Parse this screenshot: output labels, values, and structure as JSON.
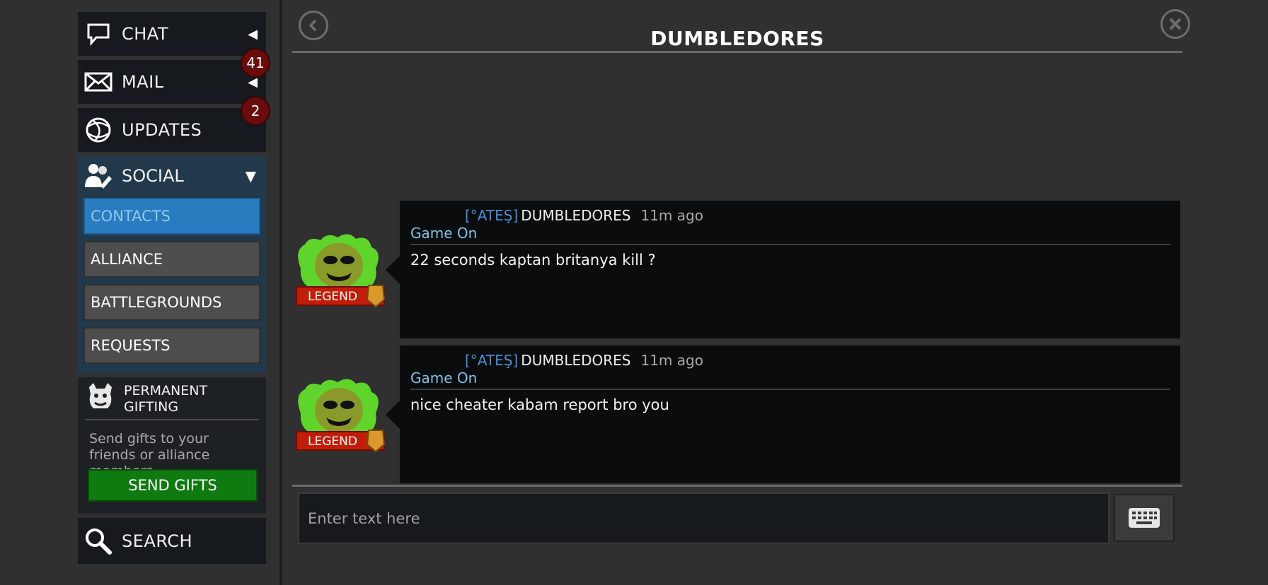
{
  "sidebar": {
    "chat": {
      "label": "CHAT",
      "icon": "speech-bubble-icon",
      "arrow": "◀"
    },
    "mail": {
      "label": "MAIL",
      "icon": "envelope-icon",
      "arrow": "◀",
      "badge": "41"
    },
    "updates": {
      "label": "UPDATES",
      "icon": "globe-icon",
      "badge": "2"
    },
    "social": {
      "label": "SOCIAL",
      "icon": "people-icon",
      "arrow": "▼",
      "items": [
        {
          "label": "CONTACTS",
          "active": true
        },
        {
          "label": "ALLIANCE"
        },
        {
          "label": "BATTLEGROUNDS"
        },
        {
          "label": "REQUESTS"
        }
      ]
    },
    "gifting": {
      "title_line1": "PERMANENT",
      "title_line2": "GIFTING",
      "description": "Send gifts to your friends or alliance members.",
      "button": "SEND GIFTS"
    },
    "search": {
      "label": "SEARCH",
      "icon": "magnifier-icon"
    }
  },
  "conversation": {
    "title": "DUMBLEDORES",
    "messages": [
      {
        "tag": "[°ATEŞ]",
        "name": "DUMBLEDORES",
        "time": "11m ago",
        "status": "Game On",
        "text": "22 seconds kaptan britanya kill ?",
        "rank": "LEGEND"
      },
      {
        "tag": "[°ATEŞ]",
        "name": "DUMBLEDORES",
        "time": "11m ago",
        "status": "Game On",
        "text": "nice cheater kabam report bro you",
        "rank": "LEGEND"
      }
    ]
  },
  "composer": {
    "placeholder": "Enter text here"
  },
  "colors": {
    "accent": "#2a7cc1",
    "badge": "#6b0c0c",
    "gift_button": "#0f7a10",
    "status": "#7fc3e8",
    "tag": "#4a8fd4"
  }
}
